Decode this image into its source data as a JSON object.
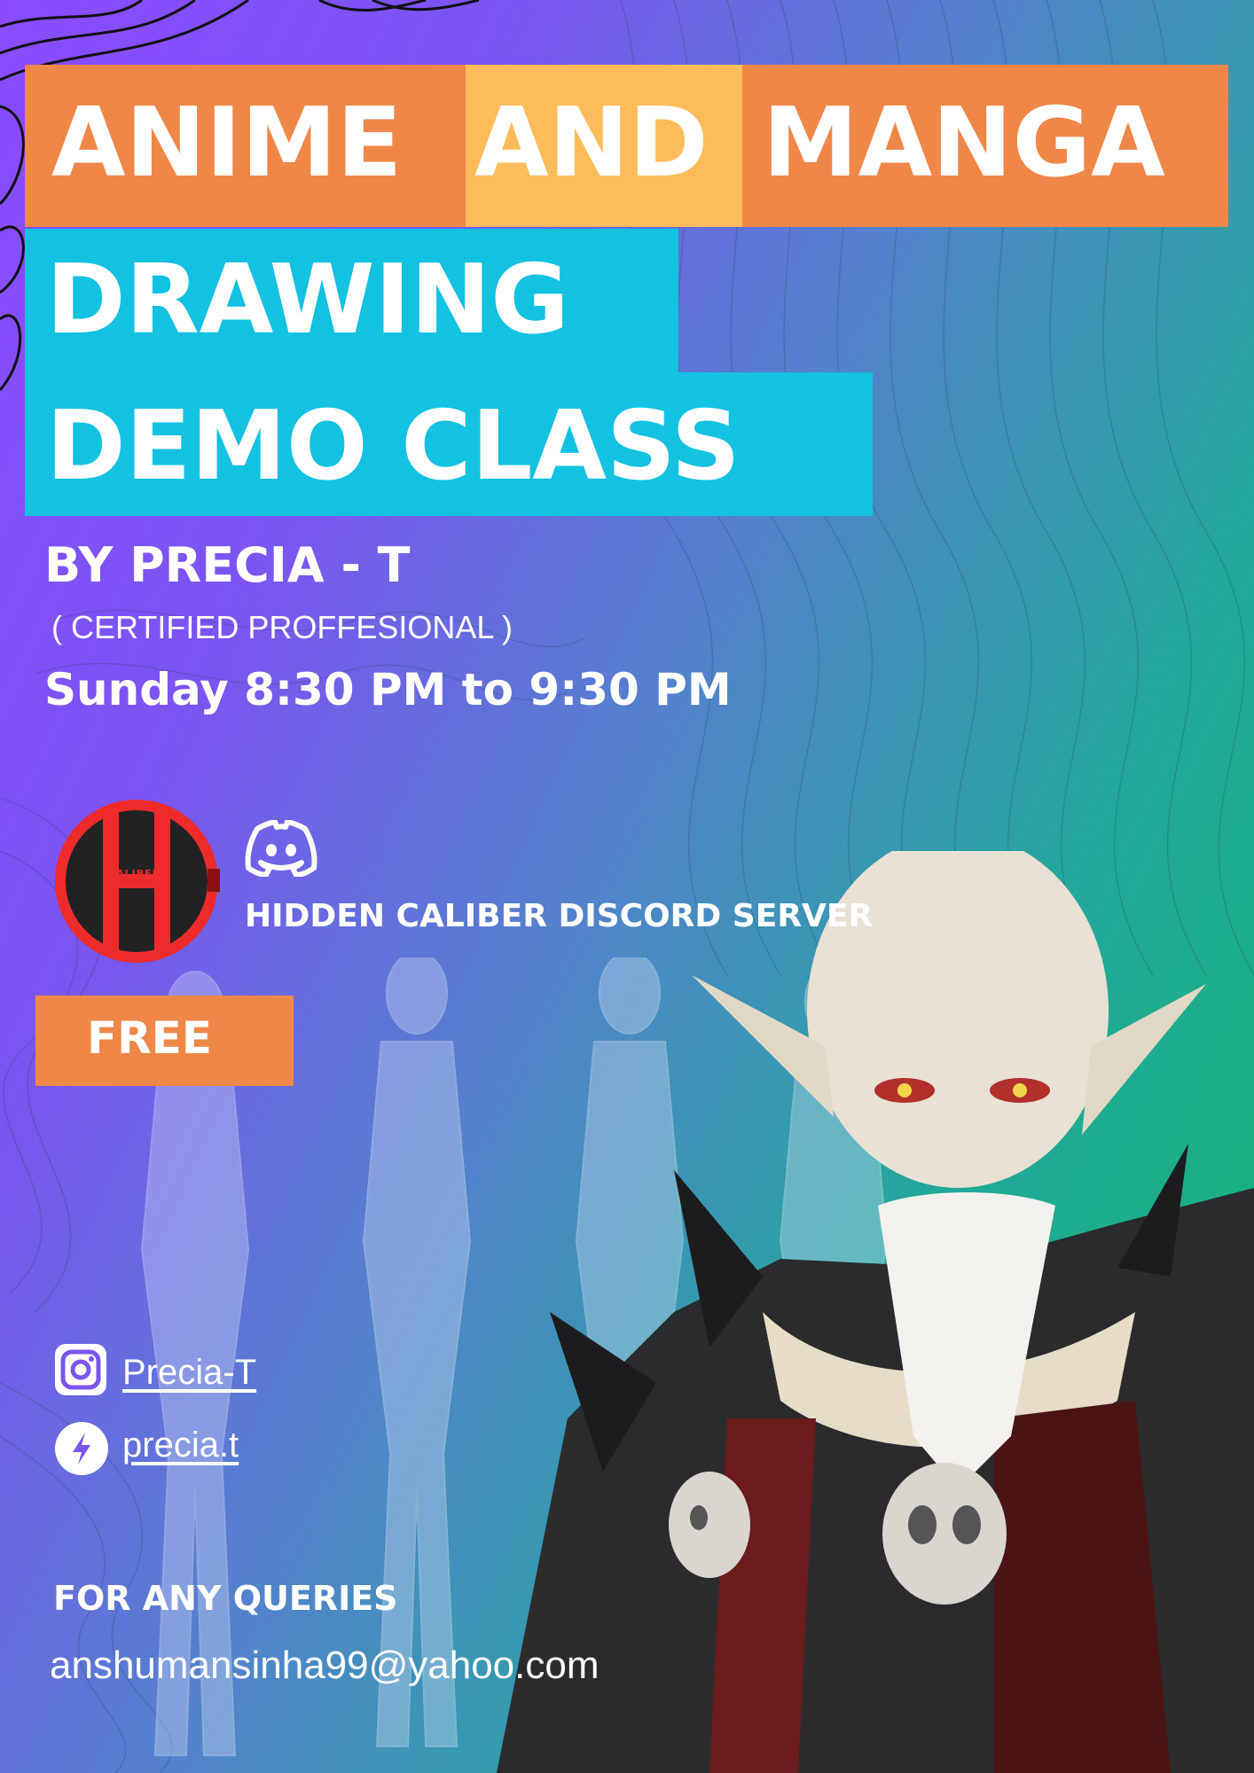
{
  "title": {
    "word1": "ANIME",
    "word2": "AND",
    "word3": "MANGA",
    "line2": "DRAWING",
    "line3": "DEMO CLASS"
  },
  "byline": "BY PRECIA - T",
  "credential": "( CERTIFIED PROFFESIONAL )",
  "schedule": "Sunday 8:30 PM to 9:30 PM",
  "logo": {
    "text": "CALIBER",
    "colors": {
      "red": "#ee2b2b",
      "black": "#222222"
    }
  },
  "discord": {
    "icon": "discord-icon",
    "label": "HIDDEN CALIBER DISCORD SERVER"
  },
  "price": "FREE",
  "socials": [
    {
      "icon": "instagram-icon",
      "handle": "Precia-T"
    },
    {
      "icon": "threads-icon",
      "handle": "precia.t"
    }
  ],
  "contact": {
    "heading": "FOR ANY QUERIES",
    "email": "anshumansinha99@yahoo.com"
  },
  "colors": {
    "orange": "#ef8748",
    "yellow": "#fdbb5a",
    "cyan": "#13c1e1",
    "purple": "#8a4bff",
    "green": "#10b86a"
  }
}
